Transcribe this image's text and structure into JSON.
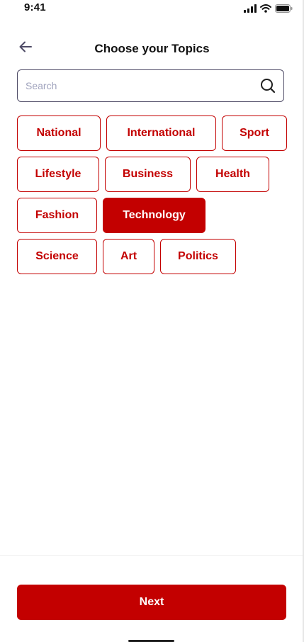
{
  "status_bar": {
    "time": "9:41",
    "icons": [
      "cellular-signal-icon",
      "wifi-icon",
      "battery-icon"
    ]
  },
  "header": {
    "title": "Choose your Topics",
    "back_icon": "arrow-left-icon"
  },
  "search": {
    "placeholder": "Search",
    "value": "",
    "icon": "search-icon"
  },
  "topics": [
    {
      "label": "National",
      "selected": false
    },
    {
      "label": "International",
      "selected": false
    },
    {
      "label": "Sport",
      "selected": false
    },
    {
      "label": "Lifestyle",
      "selected": false
    },
    {
      "label": "Business",
      "selected": false
    },
    {
      "label": "Health",
      "selected": false
    },
    {
      "label": "Fashion",
      "selected": false
    },
    {
      "label": "Technology",
      "selected": true
    },
    {
      "label": "Science",
      "selected": false
    },
    {
      "label": "Art",
      "selected": false
    },
    {
      "label": "Politics",
      "selected": false
    }
  ],
  "footer": {
    "next_label": "Next"
  },
  "colors": {
    "accent": "#c30000",
    "text": "#111111",
    "placeholder": "#a0a3bd",
    "border": "#4e4b66"
  }
}
